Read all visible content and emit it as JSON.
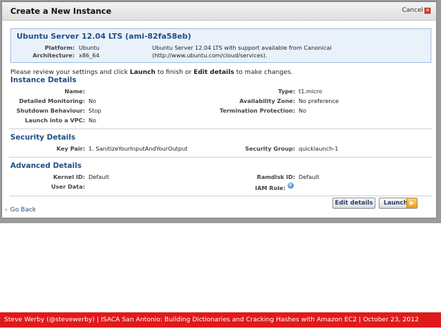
{
  "dialog": {
    "title": "Create a New Instance",
    "cancel_label": "Cancel"
  },
  "ami": {
    "title": "Ubuntu Server 12.04 LTS (ami-82fa58eb)",
    "platform_label": "Platform:",
    "platform_value": "Ubuntu",
    "architecture_label": "Architecture:",
    "architecture_value": "x86_64",
    "description": "Ubuntu Server 12.04 LTS with support available from Canonical (http://www.ubuntu.com/cloud/services)."
  },
  "instruction": {
    "before": "Please review your settings and click ",
    "launch_word": "Launch",
    "middle": " to finish or ",
    "edit_word": "Edit details",
    "after": " to make changes."
  },
  "instance_details": {
    "heading": "Instance Details",
    "name_label": "Name:",
    "name_value": "",
    "detailed_monitoring_label": "Detailed Monitoring:",
    "detailed_monitoring_value": "No",
    "shutdown_behaviour_label": "Shutdown Behaviour:",
    "shutdown_behaviour_value": "Stop",
    "launch_vpc_label": "Launch into a VPC:",
    "launch_vpc_value": "No",
    "type_label": "Type:",
    "type_value": "t1.micro",
    "availability_zone_label": "Availability Zone:",
    "availability_zone_value": "No preference",
    "termination_protection_label": "Termination Protection:",
    "termination_protection_value": "No"
  },
  "security_details": {
    "heading": "Security Details",
    "key_pair_label": "Key Pair:",
    "key_pair_value": "1. SanitizeYourInputAndYourOutput",
    "security_group_label": "Security Group:",
    "security_group_value": "quicklaunch-1"
  },
  "advanced_details": {
    "heading": "Advanced Details",
    "kernel_id_label": "Kernel ID:",
    "kernel_id_value": "Default",
    "user_data_label": "User Data:",
    "user_data_value": "",
    "ramdisk_id_label": "Ramdisk ID:",
    "ramdisk_id_value": "Default",
    "iam_role_label": "IAM Role:"
  },
  "actions": {
    "go_back_label": "Go Back",
    "edit_details_label": "Edit details",
    "launch_label": "Launch"
  },
  "footer": {
    "text": "Steve Werby (@stevewerby) | ISACA San Antonio: Building Dictionaries and Cracking Hashes with Amazon EC2 | October 23, 2012"
  },
  "colors": {
    "accent_blue": "#1f4f86",
    "footer_red": "#e01a1a",
    "launch_orange": "#f39a12"
  }
}
